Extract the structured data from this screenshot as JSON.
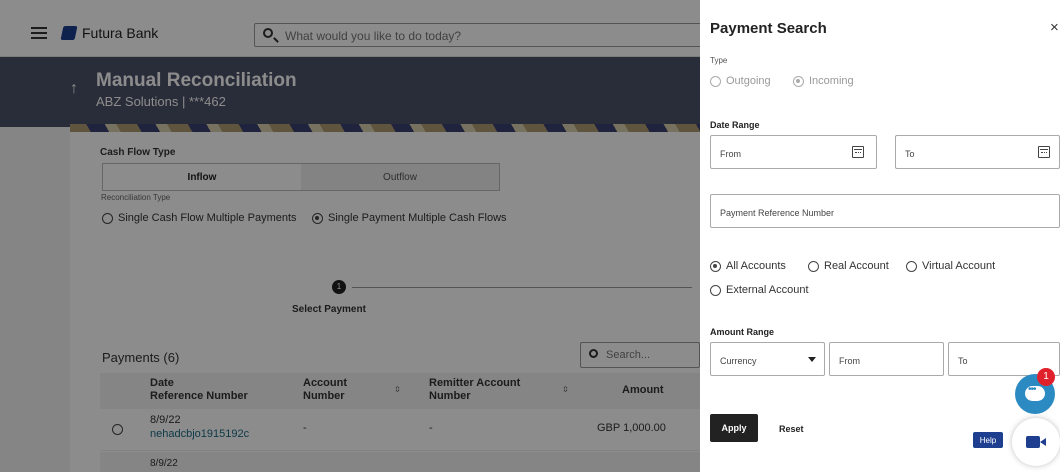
{
  "topbar": {
    "bank_name": "Futura Bank",
    "search_placeholder": "What would you like to do today?"
  },
  "hero": {
    "title": "Manual Reconciliation",
    "subtitle": "ABZ Solutions | ***462"
  },
  "form": {
    "cash_flow_type_label": "Cash Flow Type",
    "cash_flow_options": [
      "Inflow",
      "Outflow"
    ],
    "cash_flow_selected": "Inflow",
    "reconciliation_type_label": "Reconciliation Type",
    "reconciliation_options": [
      "Single Cash Flow Multiple Payments",
      "Single Payment Multiple Cash Flows"
    ],
    "reconciliation_selected": "Single Payment Multiple Cash Flows"
  },
  "stepper": {
    "step_number": "1",
    "step_label": "Select Payment"
  },
  "payments": {
    "title": "Payments (6)",
    "search_placeholder": "Search...",
    "columns": [
      {
        "line1": "Date",
        "line2": "Reference Number"
      },
      {
        "line1": "Account",
        "line2": "Number"
      },
      {
        "line1": "Remitter Account",
        "line2": "Number"
      },
      {
        "line1": "Amount",
        "line2": ""
      }
    ],
    "rows": [
      {
        "date": "8/9/22",
        "reference": "nehadcbjo1915192c",
        "account": "-",
        "remitter": "-",
        "amount": "GBP 1,000.00"
      }
    ],
    "partial_row_date": "8/9/22"
  },
  "drawer": {
    "title": "Payment Search",
    "close": "×",
    "type_label": "Type",
    "type_options": [
      "Outgoing",
      "Incoming"
    ],
    "type_selected": "Incoming",
    "date_range_label": "Date Range",
    "date_from": "From",
    "date_to": "To",
    "payment_reference_placeholder": "Payment Reference Number",
    "account_options": [
      "All Accounts",
      "Real Account",
      "Virtual Account",
      "External Account"
    ],
    "account_selected": "All Accounts",
    "amount_range_label": "Amount Range",
    "currency_placeholder": "Currency",
    "amount_from": "From",
    "amount_to": "To",
    "apply_label": "Apply",
    "reset_label": "Reset"
  },
  "widgets": {
    "chat_notifications": "1",
    "help_label": "Help"
  }
}
